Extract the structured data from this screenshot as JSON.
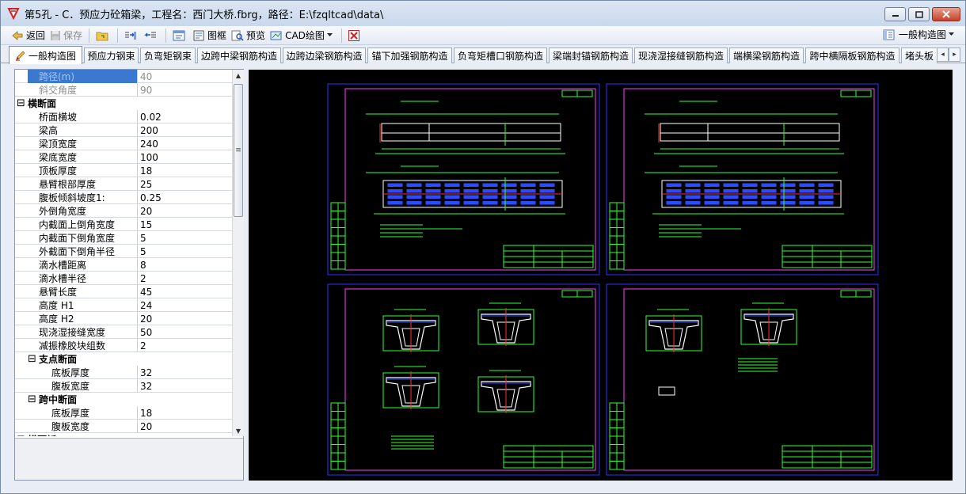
{
  "window": {
    "title": "第5孔 - C．预应力砼箱梁，工程名：西门大桥.fbrg，路径：E:\\fzqltcad\\data\\"
  },
  "toolbar": {
    "back_label": "返回",
    "save_label": "保存",
    "frame_label": "图框",
    "preview_label": "预览",
    "cad_label": "CAD绘图",
    "view_label": "一般构造图"
  },
  "tabs": [
    {
      "label": "一般构造图"
    },
    {
      "label": "预应力钢束"
    },
    {
      "label": "负弯矩钢束"
    },
    {
      "label": "边跨中梁钢筋构造"
    },
    {
      "label": "边跨边梁钢筋构造"
    },
    {
      "label": "锚下加强钢筋构造"
    },
    {
      "label": "负弯矩槽口钢筋构造"
    },
    {
      "label": "梁端封锚钢筋构造"
    },
    {
      "label": "现浇湿接缝钢筋构造"
    },
    {
      "label": "端横梁钢筋构造"
    },
    {
      "label": "跨中横隔板钢筋构造"
    },
    {
      "label": "堵头板"
    }
  ],
  "properties": [
    {
      "kind": "item",
      "name": "跨径(m)",
      "value": "40",
      "state": "selected"
    },
    {
      "kind": "item",
      "name": "斜交角度",
      "value": "90",
      "state": "dim"
    },
    {
      "kind": "cat",
      "name": "横断面",
      "expander": "⊟"
    },
    {
      "kind": "item",
      "name": "桥面横坡",
      "value": "0.02"
    },
    {
      "kind": "item",
      "name": "梁高",
      "value": "200"
    },
    {
      "kind": "item",
      "name": "梁顶宽度",
      "value": "240"
    },
    {
      "kind": "item",
      "name": "梁底宽度",
      "value": "100"
    },
    {
      "kind": "item",
      "name": "顶板厚度",
      "value": "18"
    },
    {
      "kind": "item",
      "name": "悬臂根部厚度",
      "value": "25"
    },
    {
      "kind": "item",
      "name": "腹板倾斜坡度1:",
      "value": "0.25"
    },
    {
      "kind": "item",
      "name": "外倒角宽度",
      "value": "20"
    },
    {
      "kind": "item",
      "name": "内截面上倒角宽度",
      "value": "15"
    },
    {
      "kind": "item",
      "name": "内截面下倒角宽度",
      "value": "5"
    },
    {
      "kind": "item",
      "name": "外截面下倒角半径",
      "value": "5"
    },
    {
      "kind": "item",
      "name": "滴水槽距离",
      "value": "8"
    },
    {
      "kind": "item",
      "name": "滴水槽半径",
      "value": "2"
    },
    {
      "kind": "item",
      "name": "悬臂长度",
      "value": "45"
    },
    {
      "kind": "item",
      "name": "高度 H1",
      "value": "24"
    },
    {
      "kind": "item",
      "name": "高度 H2",
      "value": "20"
    },
    {
      "kind": "item",
      "name": "现浇湿接缝宽度",
      "value": "50"
    },
    {
      "kind": "item",
      "name": "减振橡胶块组数",
      "value": "2"
    },
    {
      "kind": "subcat",
      "name": "支点断面",
      "expander": "⊟"
    },
    {
      "kind": "subitem",
      "name": "底板厚度",
      "value": "32"
    },
    {
      "kind": "subitem",
      "name": "腹板宽度",
      "value": "32"
    },
    {
      "kind": "subcat",
      "name": "跨中断面",
      "expander": "⊟"
    },
    {
      "kind": "subitem",
      "name": "底板厚度",
      "value": "18"
    },
    {
      "kind": "subitem",
      "name": "腹板宽度",
      "value": "20"
    },
    {
      "kind": "cat",
      "name": "横隔板",
      "expander": "⊟"
    }
  ],
  "colors": {
    "cad_background": "#000000",
    "sheet_frame": "#3030ff",
    "inner_frame": "#ff40ff",
    "drawing_white": "#ffffff",
    "drawing_green": "#33ff33",
    "drawing_blue": "#2a4bff",
    "drawing_red": "#ff3030",
    "selection": "#3b78d0"
  }
}
